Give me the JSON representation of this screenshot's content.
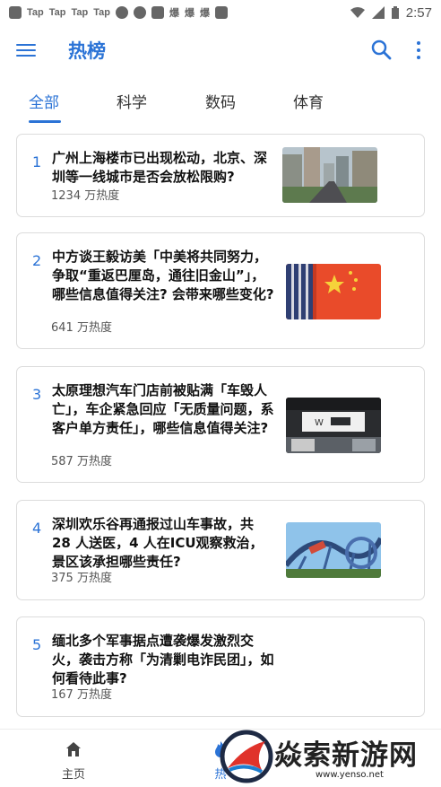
{
  "status_bar": {
    "items": [
      "Tap",
      "Tap",
      "Tap",
      "Tap"
    ],
    "extra_text": [
      "爆",
      "爆",
      "爆"
    ],
    "time": "2:57"
  },
  "app_bar": {
    "title": "热榜",
    "icons": [
      "menu-icon",
      "search-icon",
      "more-vert-icon"
    ],
    "accent_color": "#2b73d6"
  },
  "tabs": [
    {
      "label": "全部",
      "active": true
    },
    {
      "label": "科学",
      "active": false
    },
    {
      "label": "数码",
      "active": false
    },
    {
      "label": "体育",
      "active": false
    }
  ],
  "items": [
    {
      "rank": "1",
      "title": "广州上海楼市已出现松动，北京、深圳等一线城市是否会放松限购?",
      "heat": "1234 万热度",
      "has_image": true,
      "image": "city-buildings"
    },
    {
      "rank": "2",
      "title": "中方谈王毅访美「中美将共同努力，争取“重返巴厘岛，通往旧金山”」，哪些信息值得关注? 会带来哪些变化?",
      "heat": "641 万热度",
      "has_image": true,
      "image": "flags"
    },
    {
      "rank": "3",
      "title": "太原理想汽车门店前被贴满「车毁人亡」，车企紧急回应「无质量问题，系客户单方责任」，哪些信息值得关注?",
      "heat": "587 万热度",
      "has_image": true,
      "image": "car-store"
    },
    {
      "rank": "4",
      "title": "深圳欢乐谷再通报过山车事故，共 28 人送医，4 人在ICU观察救治，景区该承担哪些责任?",
      "heat": "375 万热度",
      "has_image": true,
      "image": "roller-coaster"
    },
    {
      "rank": "5",
      "title": "缅北多个军事据点遭袭爆发激烈交火，袭击方称「为清剿电诈民团」，如何看待此事?",
      "heat": "167 万热度",
      "has_image": false
    }
  ],
  "bottom_nav": [
    {
      "label": "主页",
      "icon": "home-icon"
    },
    {
      "label": "热",
      "icon": "fire-icon"
    }
  ],
  "watermark": {
    "text": "焱索新游网",
    "url": "www.yenso.net"
  }
}
